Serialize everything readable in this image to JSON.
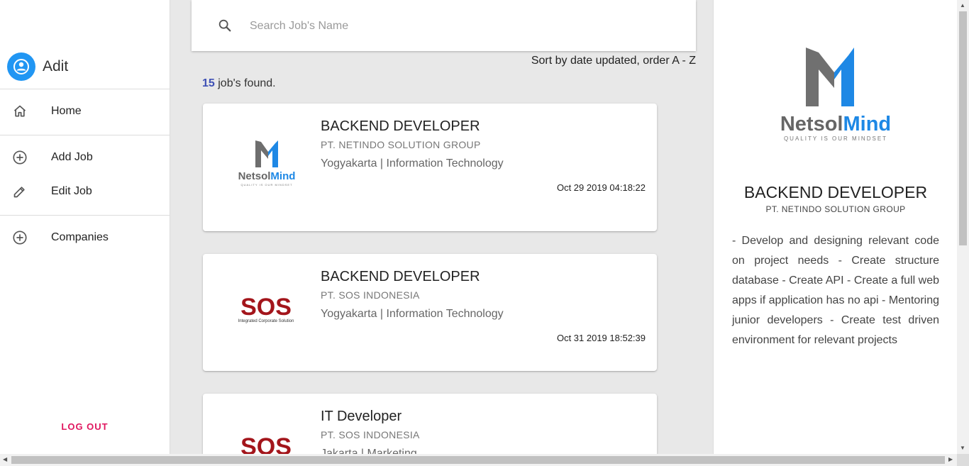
{
  "user": {
    "name": "Adit"
  },
  "nav": {
    "home": "Home",
    "add_job": "Add Job",
    "edit_job": "Edit Job",
    "companies": "Companies",
    "logout": "LOG OUT"
  },
  "search": {
    "placeholder": "Search Job's Name",
    "value": ""
  },
  "sort_label": "Sort by date updated, order A - Z",
  "results": {
    "count": "15",
    "suffix": " job's found."
  },
  "jobs": [
    {
      "title": "BACKEND DEVELOPER",
      "company": "PT. NETINDO SOLUTION GROUP",
      "location": "Yogyakarta | Information Technology",
      "date": "Oct 29 2019 04:18:22",
      "logo": "netsolmind-logo"
    },
    {
      "title": "BACKEND DEVELOPER",
      "company": "PT. SOS INDONESIA",
      "location": "Yogyakarta | Information Technology",
      "date": "Oct 31 2019 18:52:39",
      "logo": "sos-logo"
    },
    {
      "title": "IT Developer",
      "company": "PT. SOS INDONESIA",
      "location": "Jakarta | Marketing",
      "date": "",
      "logo": "sos-logo"
    }
  ],
  "logos": {
    "netsolmind": {
      "name_a": "Netsol",
      "name_b": "Mind",
      "tagline": "QUALITY IS OUR MINDSET"
    },
    "sos": {
      "name": "SOS",
      "tagline": "Integrated Corporate Solution"
    }
  },
  "detail": {
    "title": "BACKEND DEVELOPER",
    "company": "PT. NETINDO SOLUTION GROUP",
    "description": "- Develop and designing relevant code on project needs - Create structure database - Create API - Create a full web apps if application has no api - Mentoring junior developers - Create test driven environment for relevant projects"
  },
  "colors": {
    "accent": "#2196f3",
    "logout": "#e0175f",
    "count": "#3f51b5",
    "sos_red": "#a3151b"
  }
}
